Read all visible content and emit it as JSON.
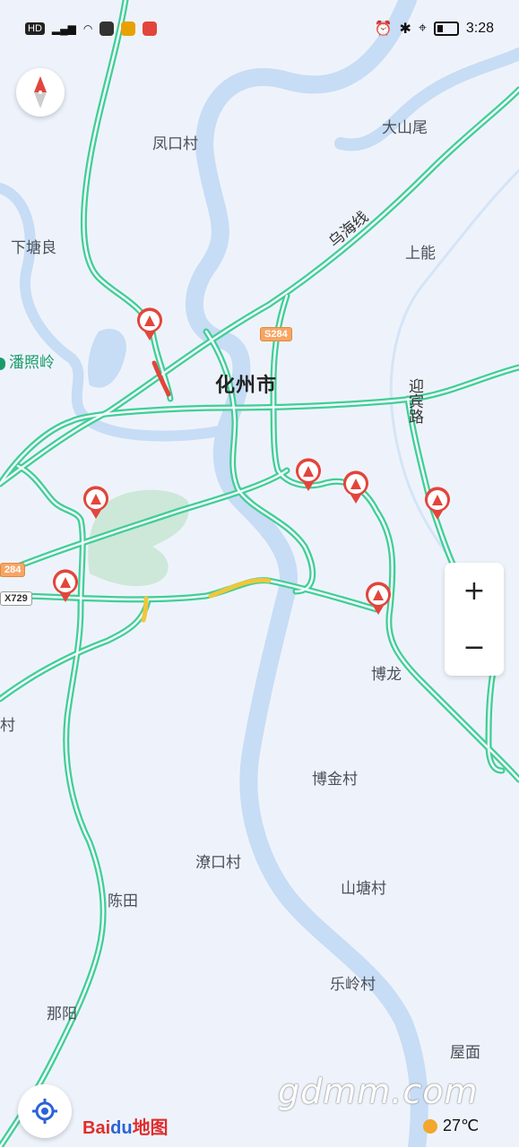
{
  "status_bar": {
    "left_indicators": [
      "HD",
      "56",
      "signal",
      "wifi",
      "link-icon",
      "jd-icon",
      "app-icon",
      "weibo-icon",
      "app-icon"
    ],
    "time": "3:28"
  },
  "map": {
    "city": "化州市",
    "places": [
      "凤口村",
      "大山尾",
      "下塘良",
      "上能",
      "博龙",
      "博金村",
      "潦口村",
      "山塘村",
      "陈田",
      "乐岭村",
      "那阳",
      "屋面",
      "村"
    ],
    "poi": "潘照岭",
    "road_shields": [
      "S284",
      "284",
      "X729"
    ],
    "road_names": [
      "乌海线",
      "迎宾路"
    ]
  },
  "controls": {
    "zoom_in": "+",
    "zoom_out": "−"
  },
  "brand": {
    "text_left": "Bai",
    "text_mid": "du",
    "text_right": "地图"
  },
  "watermark": "gdmm.com",
  "weather": {
    "temp": "27℃"
  },
  "colors": {
    "road": "#3fcf95",
    "road_slow": "#f2c63a",
    "road_jam": "#e2453c",
    "river": "#c7dcf5",
    "background": "#eef3fb",
    "marker": "#e2453c"
  }
}
